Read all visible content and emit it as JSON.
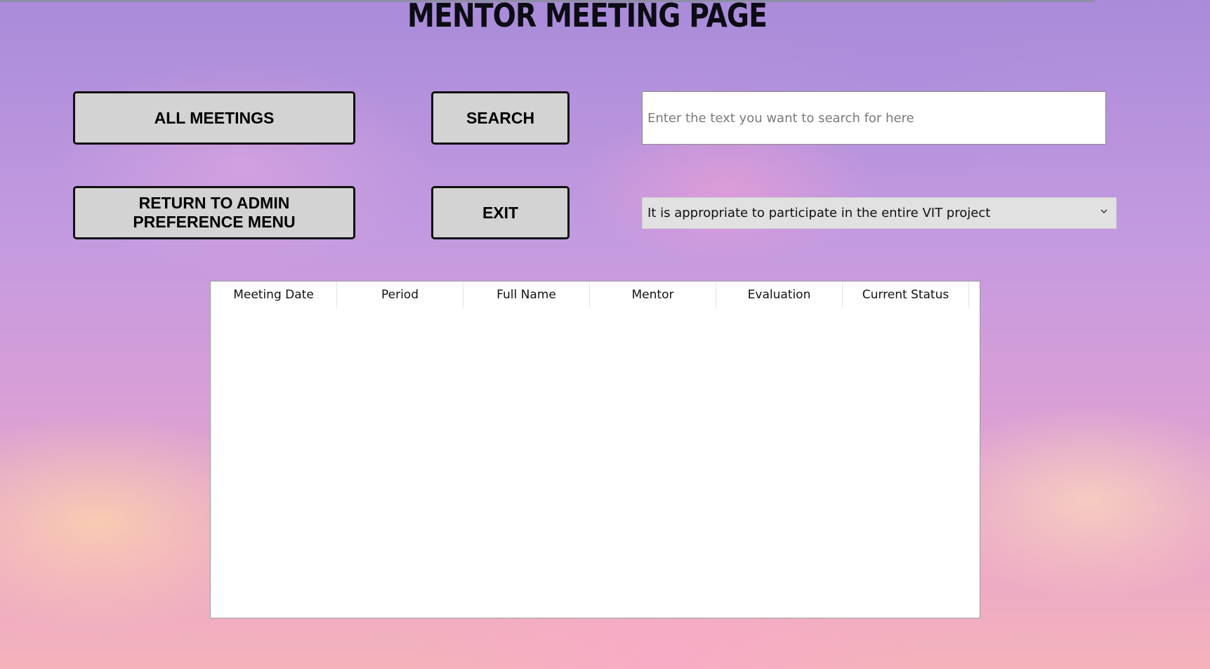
{
  "page": {
    "title": "MENTOR MEETING PAGE"
  },
  "buttons": {
    "all_meetings": "ALL MEETINGS",
    "search": "SEARCH",
    "return_admin": "RETURN TO ADMIN\nPREFERENCE MENU",
    "exit": "EXIT"
  },
  "search": {
    "value": "",
    "placeholder": "Enter the text you want to search for here"
  },
  "filter": {
    "selected": "It is appropriate to participate in the entire VIT project",
    "icon": "chevron-down-icon"
  },
  "table": {
    "columns": [
      "Meeting Date",
      "Period",
      "Full Name",
      "Mentor",
      "Evaluation",
      "Current Status"
    ],
    "rows": []
  },
  "colors": {
    "button_bg": "#d3d3d3",
    "button_border": "#111111",
    "dropdown_bg": "#e1e1e1",
    "grid_bg": "#ffffff"
  }
}
